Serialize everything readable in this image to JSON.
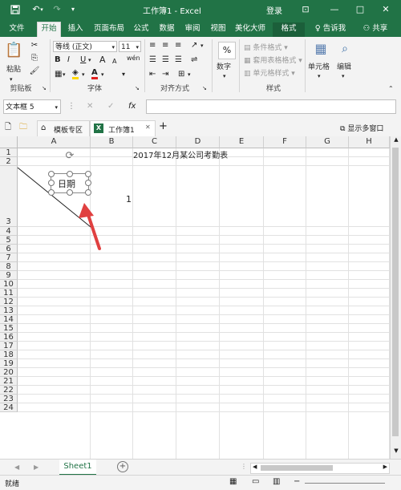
{
  "window": {
    "doc_title": "工作簿1 - Excel",
    "login_label": "登录",
    "controls": {
      "ribbon_opts": "⊡",
      "minimize": "—",
      "maximize": "□",
      "close": "✕"
    }
  },
  "quick_access": {
    "save_icon": "save-icon",
    "undo_icon": "undo-icon",
    "redo_icon": "redo-icon"
  },
  "ribbon_tabs": [
    {
      "label": "文件"
    },
    {
      "label": "开始"
    },
    {
      "label": "插入"
    },
    {
      "label": "页面布局"
    },
    {
      "label": "公式"
    },
    {
      "label": "数据"
    },
    {
      "label": "审阅"
    },
    {
      "label": "视图"
    },
    {
      "label": "美化大师"
    },
    {
      "label": "格式"
    }
  ],
  "tell_me": "告诉我",
  "share": "共享",
  "ribbon": {
    "clipboard": {
      "paste": "粘贴",
      "group": "剪贴板"
    },
    "font": {
      "name": "等线 (正文)",
      "size": "11",
      "bold": "B",
      "italic": "I",
      "underline": "U",
      "grow": "A",
      "shrink": "A",
      "group": "字体",
      "wen": "wén"
    },
    "alignment": {
      "group": "对齐方式"
    },
    "number": {
      "percent": "%",
      "label": "数字"
    },
    "styles": {
      "conditional": "条件格式",
      "table": "套用表格格式",
      "cell_styles": "单元格样式",
      "group": "样式"
    },
    "cells": {
      "label": "单元格"
    },
    "editing": {
      "label": "编辑"
    }
  },
  "formula_bar": {
    "name_box": "文本框 5",
    "fx": "fx",
    "cancel": "✕",
    "enter": "✓",
    "value": ""
  },
  "workbook_tabs": {
    "template_tab": "模板专区",
    "workbook_tab": "工作簿1",
    "add": "+",
    "multi_window": "显示多窗口"
  },
  "sheet": {
    "columns": [
      "A",
      "B",
      "C",
      "D",
      "E",
      "F",
      "G",
      "H"
    ],
    "rows": [
      "1",
      "2",
      "3",
      "4",
      "5",
      "6",
      "7",
      "8",
      "9",
      "10",
      "11",
      "12",
      "13",
      "14",
      "15",
      "16",
      "17",
      "18",
      "19",
      "20",
      "21",
      "22",
      "23",
      "24"
    ],
    "title_cell": "2017年12月某公司考勤表",
    "textbox_text": "日期",
    "cell_b2_value": "1"
  },
  "sheet_tabs": {
    "active": "Sheet1",
    "add": "+"
  },
  "status": {
    "ready": "就绪"
  },
  "colors": {
    "excel_green": "#217346",
    "arrow_red": "#e04040"
  }
}
